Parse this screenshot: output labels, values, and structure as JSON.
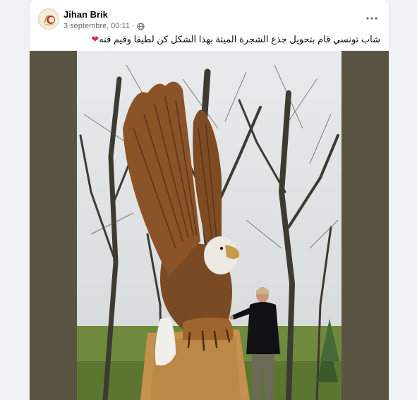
{
  "post": {
    "author": "Jihan Brik",
    "date": "3 septembre, 00:11",
    "separator": "·",
    "privacy_icon": "globe-icon",
    "more_icon": "more-horizontal-icon",
    "caption": "شاب تونسي قام بتحويل جذع الشجرة الميتة بهذا الشكل كن لطيفا وقيم فنه",
    "caption_emoji": "❤"
  },
  "colors": {
    "page_bg": "#f0f2f5",
    "card_bg": "#ffffff",
    "media_bg": "#5a5443",
    "heart": "#e0245e"
  }
}
